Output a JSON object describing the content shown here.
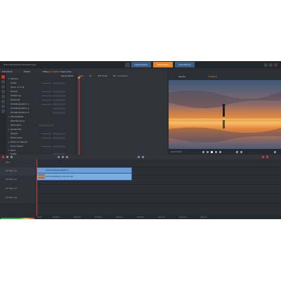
{
  "window": {
    "title": "Datei   Bearbeiten   Einstellungen"
  },
  "top_tabs": [
    {
      "label": "Organisieren",
      "active": false
    },
    {
      "label": "Bearbeiten",
      "active": true
    },
    {
      "label": "Exportieren",
      "active": false
    }
  ],
  "menubar": {
    "left_items": [
      "Bibliothek",
      "Effekt",
      "Titel",
      "Keyframes"
    ],
    "columns": [
      "Eigenschaften",
      "Media-Effekt",
      "Spur",
      "FX",
      "OFF Video",
      "Ein- und Zoom"
    ]
  },
  "props": {
    "rows": [
      "Kamera",
      "Größe",
      "Trans. X+Y+Z",
      "Drehen",
      "Skalierung",
      "Deckkraft",
      "Schattenposition 1",
      "Schattenposition 2",
      "Schattenposition 3",
      "Wechselseite",
      "Überblendung",
      "Farbmodus",
      "Randbreite",
      "Verlauf",
      "Randmodus",
      "Farbe vor Blende",
      "Darin spielen",
      "Rand",
      "Größe"
    ]
  },
  "preview": {
    "tabs": [
      "Quelle",
      "Timeline"
    ],
    "active_tab": "Timeline",
    "timecode": "00:00:00.00"
  },
  "timeline": {
    "tracks": [
      {
        "name": "Spur"
      },
      {
        "name": "A/V Spur (1)"
      },
      {
        "name": "A/V Spur (2)"
      },
      {
        "name": "A/V Spur (3)"
      },
      {
        "name": "A/V Spur (4)"
      }
    ],
    "clips": [
      {
        "label": "Sonnenuntergang Reflexion"
      },
      {
        "label": "sonnenuntergang_meer_4k.mp4"
      }
    ],
    "ruler": [
      "00:00",
      "00:00:10",
      "00:00:20",
      "00:00:30",
      "00:00:40",
      "00:00:50",
      "00:01:00",
      "00:01:10",
      "00:01:20"
    ]
  },
  "colors": {
    "accent": "#e8872a",
    "tab_blue": "#3a5e86",
    "playhead": "#e23a2e",
    "clip": "#6b9fd6"
  }
}
